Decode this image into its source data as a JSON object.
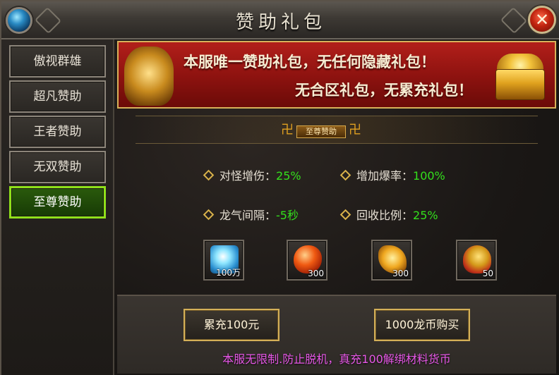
{
  "window": {
    "title": "赞助礼包"
  },
  "sidebar": {
    "items": [
      {
        "label": "傲视群雄",
        "active": false
      },
      {
        "label": "超凡赞助",
        "active": false
      },
      {
        "label": "王者赞助",
        "active": false
      },
      {
        "label": "无双赞助",
        "active": false
      },
      {
        "label": "至尊赞助",
        "active": true
      }
    ]
  },
  "banner": {
    "line1": "本服唯一赞助礼包，无任何隐藏礼包！",
    "line2": "无合区礼包，无累充礼包！"
  },
  "tier": {
    "label": "至尊赞助",
    "ornament": "卍"
  },
  "stats": [
    {
      "label": "对怪增伤：",
      "value": "25%"
    },
    {
      "label": "增加爆率：",
      "value": "100%"
    },
    {
      "label": "龙气间隔：",
      "value": "-5秒"
    },
    {
      "label": "回收比例：",
      "value": "25%"
    }
  ],
  "items": [
    {
      "icon": "diamond-gem-icon",
      "qty": "100万"
    },
    {
      "icon": "red-gem-icon",
      "qty": "300"
    },
    {
      "icon": "gold-ore-icon",
      "qty": "300"
    },
    {
      "icon": "gold-pouch-icon",
      "qty": "50"
    }
  ],
  "buttons": {
    "recharge": "累充100元",
    "buy": "1000龙币购买"
  },
  "notice": "本服无限制.防止脱机，真充100解绑材料货币",
  "colors": {
    "accent_green": "#33e01c",
    "active_border": "#8fe01a",
    "banner_red": "#b21f1a",
    "gold": "#d4b058",
    "notice_magenta": "#e858e8"
  }
}
